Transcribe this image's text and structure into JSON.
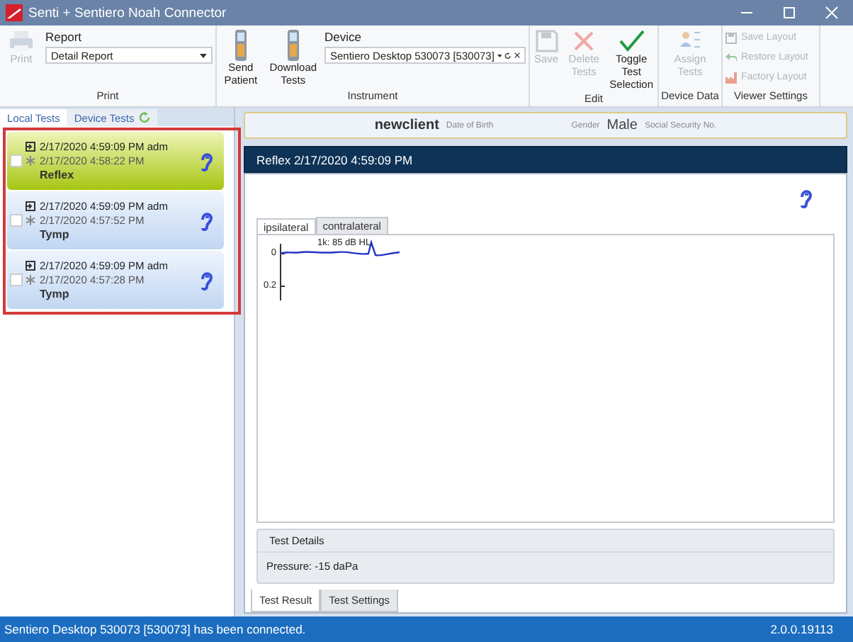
{
  "window": {
    "title": "Senti + Sentiero Noah Connector"
  },
  "ribbon": {
    "print": {
      "label": "Print",
      "print_button": {
        "label": "Print",
        "disabled": true
      },
      "report": {
        "caption": "Report",
        "value": "Detail Report"
      }
    },
    "instrument": {
      "label": "Instrument",
      "buttons": [
        {
          "label": "Send Patient",
          "disabled": false
        },
        {
          "label": "Download Tests",
          "disabled": false
        }
      ],
      "device": {
        "caption": "Device",
        "value": "Sentiero Desktop 530073 [530073]"
      }
    },
    "edit": {
      "label": "Edit",
      "buttons": [
        {
          "kind": "save",
          "label": "Save",
          "disabled": true
        },
        {
          "kind": "delete",
          "label": "Delete Tests",
          "disabled": true
        },
        {
          "kind": "toggle",
          "label": "Toggle Test Selection",
          "disabled": false
        }
      ]
    },
    "device_data": {
      "label": "Device Data",
      "buttons": [
        {
          "label": "Assign Tests",
          "disabled": true
        }
      ]
    },
    "viewer_settings": {
      "label": "Viewer Settings",
      "buttons": [
        {
          "kind": "save",
          "label": "Save Layout",
          "disabled": true
        },
        {
          "kind": "restore",
          "label": "Restore Layout",
          "disabled": true
        },
        {
          "kind": "factory",
          "label": "Factory Layout",
          "disabled": true
        }
      ]
    }
  },
  "side_tabs": [
    {
      "label": "Local Tests",
      "selected": true
    },
    {
      "label": "Device Tests",
      "selected": false
    }
  ],
  "tests": {
    "highlight_frame": true,
    "items": [
      {
        "imported": "2/17/2020 4:59:09 PM adm",
        "measured": "2/17/2020 4:58:22 PM",
        "type": "Reflex",
        "checked": false,
        "selected": true
      },
      {
        "imported": "2/17/2020 4:59:09 PM adm",
        "measured": "2/17/2020 4:57:52 PM",
        "type": "Tymp",
        "checked": false,
        "selected": false
      },
      {
        "imported": "2/17/2020 4:59:09 PM adm",
        "measured": "2/17/2020 4:57:28 PM",
        "type": "Tymp",
        "checked": false,
        "selected": false
      }
    ]
  },
  "patient": {
    "name": "newclient",
    "birth_label": "Date of Birth",
    "gender_label": "Gender",
    "gender": "Male",
    "ssn_label": "Social Security No."
  },
  "test_header": "Reflex 2/17/2020 4:59:09 PM",
  "chart_tabs": [
    {
      "label": "ipsilateral",
      "selected": true
    },
    {
      "label": "contralateral",
      "selected": false
    }
  ],
  "trace": {
    "label": "1k: 85 dB HL",
    "y_ticks": [
      "0",
      "0.2"
    ]
  },
  "test_details": {
    "title": "Test Details",
    "lines": [
      "Pressure: -15 daPa"
    ]
  },
  "bottom_tabs": [
    {
      "label": "Test Result",
      "selected": true
    },
    {
      "label": "Test Settings",
      "selected": false
    }
  ],
  "status_bar": {
    "message": "Sentiero Desktop 530073 [530073] has been connected.",
    "version": "2.0.0.19113"
  }
}
